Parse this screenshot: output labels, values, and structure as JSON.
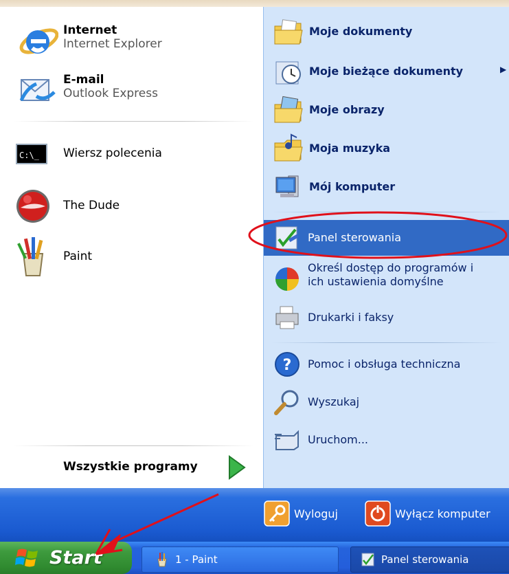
{
  "pinned": [
    {
      "title": "Internet",
      "subtitle": "Internet Explorer",
      "icon": "internet-explorer-icon"
    },
    {
      "title": "E-mail",
      "subtitle": "Outlook Express",
      "icon": "outlook-express-icon"
    }
  ],
  "recent": [
    {
      "label": "Wiersz polecenia",
      "icon": "command-prompt-icon",
      "icon_text": "C:\\_"
    },
    {
      "label": "The Dude",
      "icon": "the-dude-icon"
    },
    {
      "label": "Paint",
      "icon": "paint-icon"
    }
  ],
  "all_programs": {
    "label": "Wszystkie programy",
    "icon": "green-arrow-icon"
  },
  "places": [
    {
      "label": "Moje dokumenty",
      "icon": "my-documents-icon"
    },
    {
      "label": "Moje bieżące dokumenty",
      "icon": "recent-documents-icon",
      "arrow": "▶"
    },
    {
      "label": "Moje obrazy",
      "icon": "my-pictures-icon"
    },
    {
      "label": "Moja muzyka",
      "icon": "my-music-icon"
    },
    {
      "label": "Mój komputer",
      "icon": "my-computer-icon"
    }
  ],
  "settings": [
    {
      "label": "Panel sterowania",
      "icon": "control-panel-icon"
    },
    {
      "label_line1": "Określ dostęp do programów i",
      "label_line2": "ich ustawienia domyślne",
      "icon": "set-program-access-icon"
    },
    {
      "label": "Drukarki i faksy",
      "icon": "printers-icon"
    }
  ],
  "help": [
    {
      "label": "Pomoc i obsługa techniczna",
      "icon": "help-icon"
    },
    {
      "label": "Wyszukaj",
      "icon": "search-icon"
    },
    {
      "label": "Uruchom...",
      "icon": "run-icon"
    }
  ],
  "session": {
    "logoff": "Wyloguj",
    "shutdown": "Wyłącz komputer"
  },
  "taskbar": {
    "start": "Start",
    "items": [
      {
        "label": "1 - Paint",
        "icon": "paint-icon"
      },
      {
        "label": "Panel sterowania",
        "icon": "control-panel-icon"
      }
    ]
  },
  "colors": {
    "highlight": "#316ac5",
    "annotation": "#e0101a",
    "right_panel": "#d3e5fa",
    "start_green": "#3e9b3e",
    "taskbar_blue": "#245edb"
  }
}
